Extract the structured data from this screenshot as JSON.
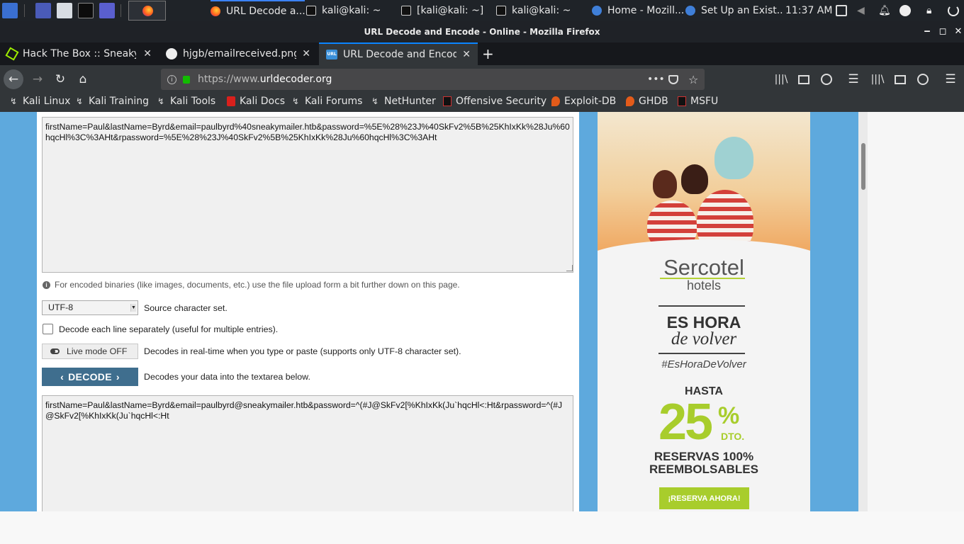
{
  "taskbar": {
    "tasks": [
      {
        "label": "URL Decode a...",
        "icon": "firefox-icon",
        "active": true
      },
      {
        "label": "kali@kali: ~",
        "icon": "terminal-icon"
      },
      {
        "label": "[kali@kali: ~]",
        "icon": "terminal-icon"
      },
      {
        "label": "kali@kali: ~",
        "icon": "terminal-icon"
      },
      {
        "label": "Home - Mozill...",
        "icon": "thunderbird-icon"
      },
      {
        "label": "Set Up an Exist...",
        "icon": "thunderbird-icon"
      }
    ],
    "clock": "11:37 AM",
    "tray_icons": [
      "display-icon",
      "volume-icon",
      "notifications-icon",
      "updates-icon",
      "lock-icon",
      "power-icon"
    ]
  },
  "window": {
    "title": "URL Decode and Encode - Online - Mozilla Firefox",
    "minimize": "‒",
    "maximize": "◻",
    "close": "✕"
  },
  "tabs": [
    {
      "label": "Hack The Box :: SneakyM",
      "icon": "htb-icon"
    },
    {
      "label": "hjgb/emailreceived.png a",
      "icon": "github-icon"
    },
    {
      "label": "URL Decode and Encode",
      "icon": "urldecoder-icon",
      "active": true
    }
  ],
  "newtab_label": "+",
  "nav": {
    "url_prefix": "https://www.",
    "url_domain": "urldecoder.org",
    "page_actions": "•••"
  },
  "bookmarks": [
    {
      "label": "Kali Linux"
    },
    {
      "label": "Kali Training"
    },
    {
      "label": "Kali Tools"
    },
    {
      "label": "Kali Docs"
    },
    {
      "label": "Kali Forums"
    },
    {
      "label": "NetHunter"
    },
    {
      "label": "Offensive Security"
    },
    {
      "label": "Exploit-DB"
    },
    {
      "label": "GHDB"
    },
    {
      "label": "MSFU"
    }
  ],
  "decoder": {
    "input_text": "firstName=Paul&lastName=Byrd&email=paulbyrd%40sneakymailer.htb&password=%5E%28%23J%40SkFv2%5B%25KhIxKk%28Ju%60hqcHl%3C%3AHt&rpassword=%5E%28%23J%40SkFv2%5B%25KhIxKk%28Ju%60hqcHl%3C%3AHt",
    "binary_note": "For encoded binaries (like images, documents, etc.) use the file upload form a bit further down on this page.",
    "charset_value": "UTF-8",
    "charset_label": "Source character set.",
    "each_line_label": "Decode each line separately (useful for multiple entries).",
    "live_mode_label": "Live mode OFF",
    "live_mode_desc": "Decodes in real-time when you type or paste (supports only UTF-8 character set).",
    "decode_label": "DECODE",
    "decode_desc": "Decodes your data into the textarea below.",
    "output_text": "firstName=Paul&lastName=Byrd&email=paulbyrd@sneakymailer.htb&password=^(#J@SkFv2[%KhIxKk(Ju`hqcHl<:Ht&rpassword=^(#J@SkFv2[%KhIxKk(Ju`hqcHl<:Ht"
  },
  "ad": {
    "brand": "Sercotel",
    "brand_sub": "hotels",
    "headline1": "ES HORA",
    "headline2": "de volver",
    "hashtag": "#EsHoraDeVolver",
    "hasta": "HASTA",
    "percent": "25",
    "percent_sign": "%",
    "dto": "DTO.",
    "reservas1": "RESERVAS 100%",
    "reservas2": "REEMBOLSABLES",
    "cta": "¡RESERVA AHORA!"
  },
  "colors": {
    "accent": "#0a84ff",
    "decode_button": "#3f6e8e",
    "page_side": "#5ea9dd",
    "ad_green": "#a8cd2c"
  }
}
